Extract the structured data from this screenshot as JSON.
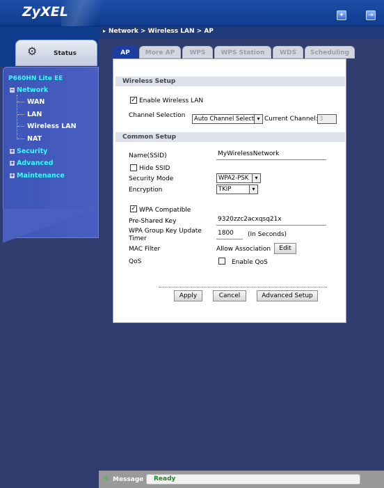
{
  "header": {
    "logo": "ZyXEL",
    "wizard_icon": "wizard-icon",
    "logout_icon": "logout-icon"
  },
  "breadcrumb": "Network > Wireless LAN > AP",
  "sidebar": {
    "status_label": "Status",
    "device_name": "P660HN Lite EE",
    "network": "Network",
    "network_items": [
      "WAN",
      "LAN",
      "Wireless LAN",
      "NAT"
    ],
    "security": "Security",
    "advanced": "Advanced",
    "maintenance": "Maintenance"
  },
  "tabs": [
    "AP",
    "More AP",
    "WPS",
    "WPS Station",
    "WDS",
    "Scheduling"
  ],
  "wireless_setup": {
    "title": "Wireless Setup",
    "enable_label": "Enable Wireless LAN",
    "enable_checked": true,
    "channel_label": "Channel Selection",
    "channel_value": "Auto Channel Select",
    "current_channel_label": "Current Channel:",
    "current_channel_value": "3"
  },
  "common_setup": {
    "title": "Common Setup",
    "ssid_label": "Name(SSID)",
    "ssid_value": "MyWirelessNetwork",
    "hide_ssid_label": "Hide SSID",
    "hide_ssid_checked": false,
    "security_mode_label": "Security Mode",
    "security_mode_value": "WPA2-PSK",
    "encryption_label": "Encryption",
    "encryption_value": "TKIP",
    "wpa_compat_label": "WPA Compatible",
    "wpa_compat_checked": true,
    "psk_label": "Pre-Shared Key",
    "psk_value": "9320zzc2acxqsq21x",
    "group_key_label_1": "WPA Group Key Update",
    "group_key_label_2": "Timer",
    "group_key_value": "1800",
    "group_key_unit": "(In Seconds)",
    "mac_filter_label": "MAC Filter",
    "mac_filter_value": "Allow Association",
    "edit_button": "Edit",
    "qos_label": "QoS",
    "enable_qos_label": "Enable QoS",
    "enable_qos_checked": false
  },
  "buttons": {
    "apply": "Apply",
    "cancel": "Cancel",
    "advanced_setup": "Advanced Setup"
  },
  "footer": {
    "message_label": "Message",
    "message_value": "Ready"
  }
}
